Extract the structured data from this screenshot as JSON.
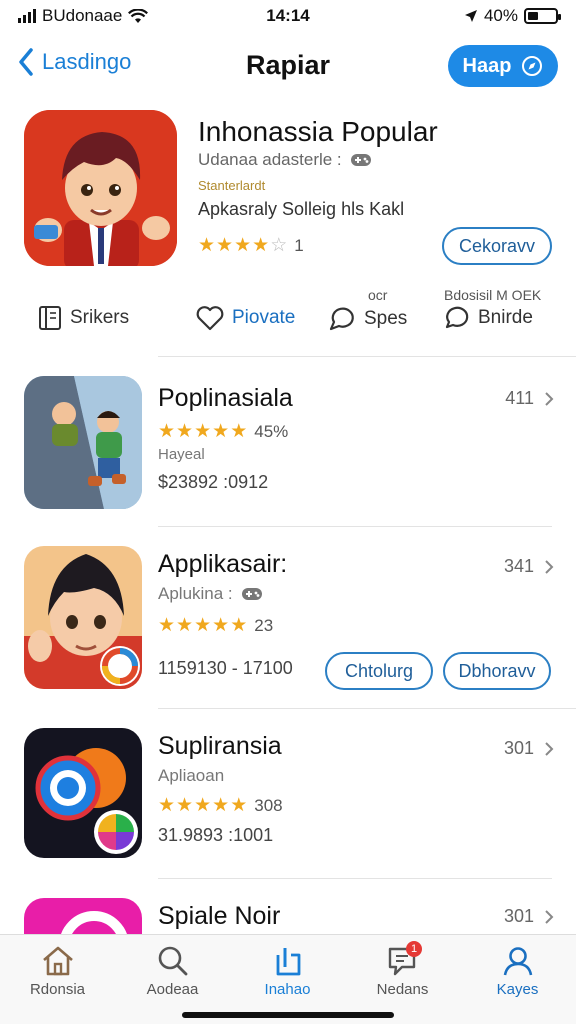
{
  "status_bar": {
    "carrier": "BUdonaae",
    "time": "14:14",
    "battery": "40%",
    "battery_level": 0.4
  },
  "nav": {
    "back_label": "Lasdingo",
    "title": "Rapiar",
    "action_label": "Haap"
  },
  "featured": {
    "title": "Inhonassia Popular",
    "subtitle": "Udanaa adasterle :",
    "badge": "Stanterlardt",
    "description": "Apkasraly Solleig hls Kakl",
    "rating_value": 4,
    "rating_count": "1",
    "get_label": "Cekoravv"
  },
  "actions": {
    "items": [
      {
        "label": "Srikers",
        "icon": "book-icon"
      },
      {
        "label": "Piovate",
        "icon": "heart-icon"
      },
      {
        "label": "Spes",
        "icon": "speech-bubble-icon",
        "top_label": "ocr"
      },
      {
        "label": "Bnirde",
        "icon": "chat-icon",
        "top_label": "Bdosisil M OEK"
      }
    ]
  },
  "apps": [
    {
      "name": "Poplinasiala",
      "count": "411",
      "rating_value": 4.5,
      "rating_text": "45%",
      "category": "Hayeal",
      "price": "$23892 :0912"
    },
    {
      "name": "Applikasair:",
      "count": "341",
      "category": "Aplukina :",
      "rating_value": 4.5,
      "rating_text": "23",
      "price": "1159130 - 17100",
      "button1": "Chtolurg",
      "button2": "Dbhoravv"
    },
    {
      "name": "Supliransia",
      "count": "301",
      "category": "Apliaoan",
      "rating_value": 4.5,
      "rating_text": "308",
      "price": "31.9893 :1001"
    },
    {
      "name": "Spiale Noir",
      "count": "301"
    }
  ],
  "tabbar": {
    "tabs": [
      {
        "label": "Rdonsia",
        "icon": "house-icon"
      },
      {
        "label": "Aodeaa",
        "icon": "search-icon"
      },
      {
        "label": "Inahao",
        "icon": "apps-icon"
      },
      {
        "label": "Nedans",
        "icon": "notification-icon",
        "badge": "1"
      },
      {
        "label": "Kayes",
        "icon": "person-icon"
      }
    ],
    "active_index": 2
  },
  "colors": {
    "accent": "#1e8ae6",
    "star": "#f0a81e",
    "outline_button": "#2b7fc4"
  }
}
